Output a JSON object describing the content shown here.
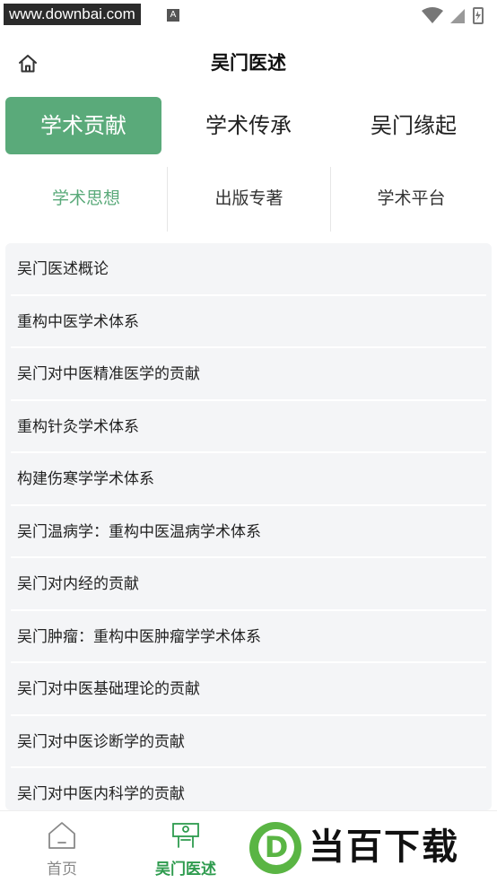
{
  "status_bar": {
    "watermark": "www.downbai.com",
    "notification_icon": "A"
  },
  "header": {
    "title": "吴门医述",
    "home_icon": "home-icon"
  },
  "primary_tabs": [
    {
      "label": "学术贡献",
      "active": true
    },
    {
      "label": "学术传承",
      "active": false
    },
    {
      "label": "吴门缘起",
      "active": false
    }
  ],
  "secondary_tabs": [
    {
      "label": "学术思想",
      "active": true
    },
    {
      "label": "出版专著",
      "active": false
    },
    {
      "label": "学术平台",
      "active": false
    }
  ],
  "list_items": [
    "吴门医述概论",
    "重构中医学术体系",
    "吴门对中医精准医学的贡献",
    "重构针灸学术体系",
    "构建伤寒学学术体系",
    "吴门温病学：重构中医温病学术体系",
    "吴门对内经的贡献",
    "吴门肿瘤：重构中医肿瘤学学术体系",
    "吴门对中医基础理论的贡献",
    "吴门对中医诊断学的贡献",
    "吴门对中医内科学的贡献"
  ],
  "bottom_nav": [
    {
      "label": "首页",
      "active": false
    },
    {
      "label": "吴门医述",
      "active": true
    }
  ],
  "brand_logo": {
    "mark": "D",
    "text": "当百下载"
  },
  "colors": {
    "accent": "#5aaa7a",
    "nav_active": "#2e9b4e",
    "list_bg": "#f4f5f7"
  }
}
